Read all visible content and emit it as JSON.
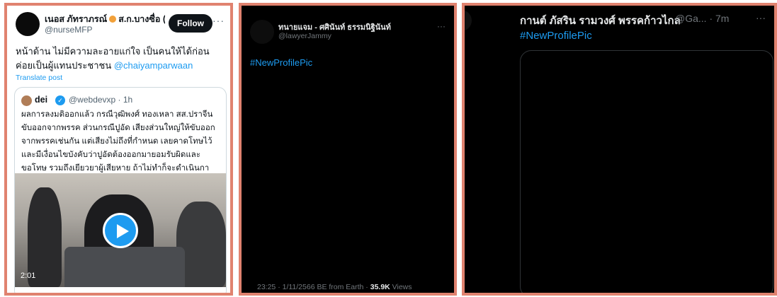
{
  "panel1": {
    "author_name": "เนอส ภัทราภรณ์",
    "author_location": "ส.ก.บางซื่อ (ไม่",
    "handle": "@nurseMFP",
    "follow_label": "Follow",
    "more_icon": "···",
    "tweet_text": "หน้าด้าน ไม่มีความละอายแก่ใจ เป็นคนให้ได้ก่อนค่อยเป็นผู้แทนประชาชน",
    "tweet_mention": "@chaiyamparwaan",
    "translate_label": "Translate post",
    "quote": {
      "name": "dei",
      "verified_icon": "✓",
      "handle_time": "@webdevxp · 1h",
      "text": "ผลการลงมติออกแล้ว กรณีวุฒิพงศ์ ทองเหลา สส.ปราจีน ขับออกจากพรรค ส่วนกรณีปูอัด เสียงส่วนใหญ่ให้ขับออกจากพรรคเช่นกัน แต่เสียงไม่ถึงที่กำหนด เลยคาดโทษไว้ และมีเงื่อนไขบังคับว่าปูอัดต้องออกมายอมรับผิดและขอโทษ รวมถึงเยียวยาผู้เสียหาย ถ้าไม่ทำก็จะดำเนินการอื่นๆ ต่อไป",
      "video_duration": "2:01"
    }
  },
  "panel2": {
    "author_name": "ทนายแจม - ศศินันท์ ธรรมนิฐินันท์",
    "handle": "@lawyerJammy",
    "more_icon": "···",
    "hashtag": "#NewProfilePic",
    "meta_prefix": "23:25 · 1/11/2566 BE from Earth · ",
    "views_count": "35.9K",
    "views_label": " Views"
  },
  "panel3": {
    "author_name": "กานต์ ภัสริน รามวงศ์ พรรคก้าวไกล",
    "handle_time": "@Ga... · 7m",
    "more_icon": "···",
    "hashtag": "#NewProfilePic"
  },
  "colors": {
    "border": "#e0826f",
    "link": "#1d9bf0",
    "dark_bg": "#000000"
  }
}
